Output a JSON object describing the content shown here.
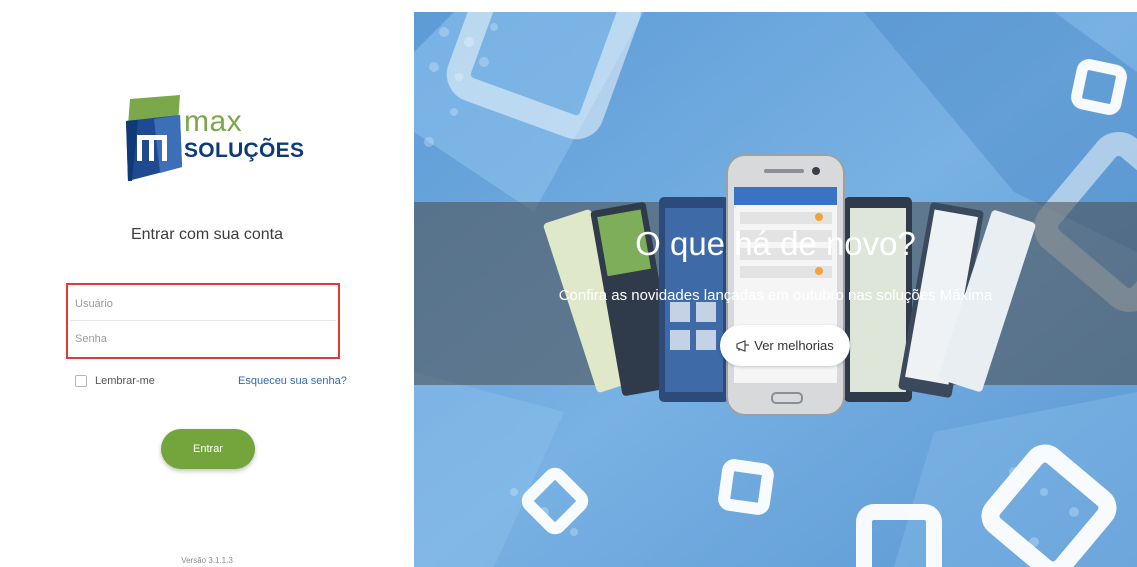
{
  "brand": {
    "logo_line1": "max",
    "logo_line2": "SOLUÇÕES"
  },
  "login": {
    "heading": "Entrar com sua conta",
    "username_placeholder": "Usuário",
    "password_placeholder": "Senha",
    "remember_label": "Lembrar-me",
    "forgot_link": "Esqueceu sua senha?",
    "submit_label": "Entrar",
    "version": "Versão 3.1.1.3"
  },
  "promo": {
    "title": "O que há de novo?",
    "subtitle": "Confira as novidades lançadas em outubro nas soluções Máxima",
    "button_label": "Ver melhorias",
    "button_icon": "megaphone-icon"
  },
  "colors": {
    "accent_green": "#74a43c",
    "brand_navy": "#0f3a78",
    "link_blue": "#2f6ab5",
    "highlight_red": "#e53935",
    "promo_blue": "#6fa8dc"
  }
}
